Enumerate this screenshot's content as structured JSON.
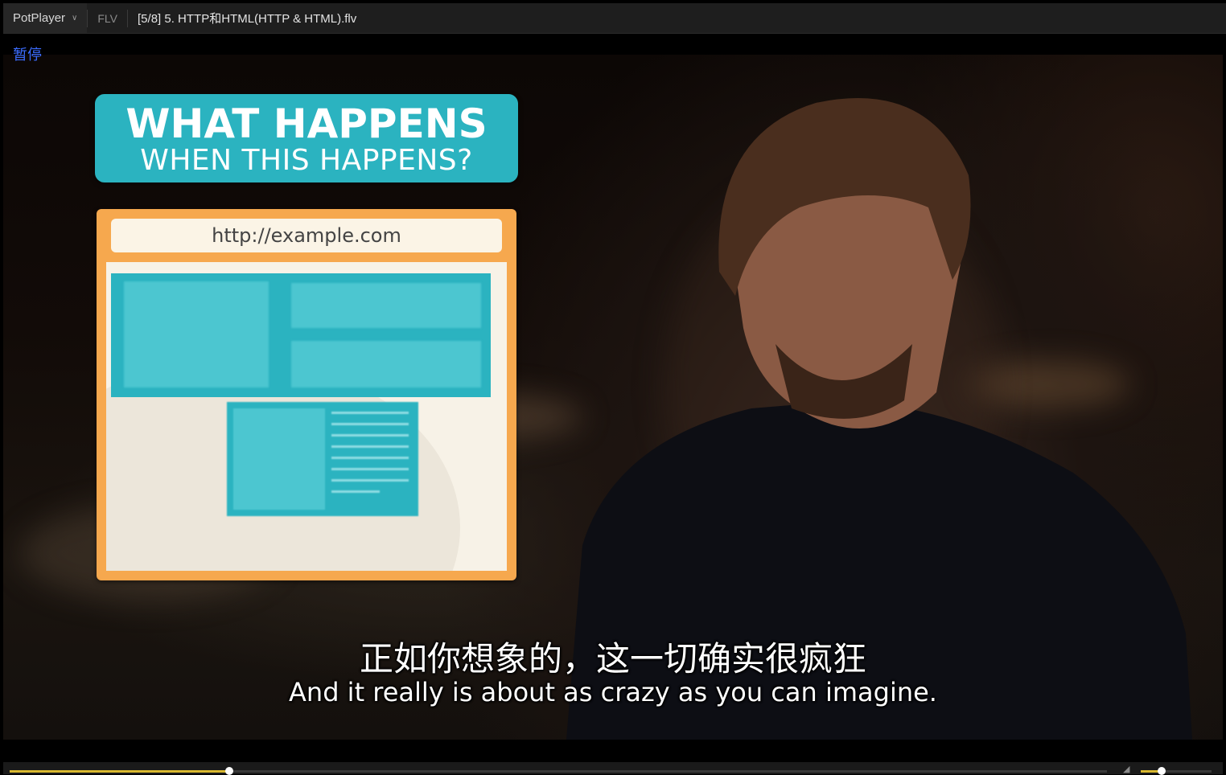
{
  "titlebar": {
    "app_name": "PotPlayer",
    "format": "FLV",
    "file_title": "[5/8] 5. HTTP和HTML(HTTP & HTML).flv"
  },
  "osd": {
    "status": "暂停"
  },
  "video": {
    "title_card": {
      "line1": "WHAT HAPPENS",
      "line2": "WHEN THIS HAPPENS?"
    },
    "browser_url": "http://example.com",
    "subtitle_cn": "正如你想象的，这一切确实很疯狂",
    "subtitle_en": "And it really is about as crazy as you can imagine."
  },
  "playback": {
    "progress_fraction": 0.2,
    "volume_fraction": 0.3
  },
  "colors": {
    "accent": "#d9b830",
    "osd_text": "#3b6cff",
    "card_teal": "#2bb3c0",
    "card_orange": "#f6a84e"
  }
}
